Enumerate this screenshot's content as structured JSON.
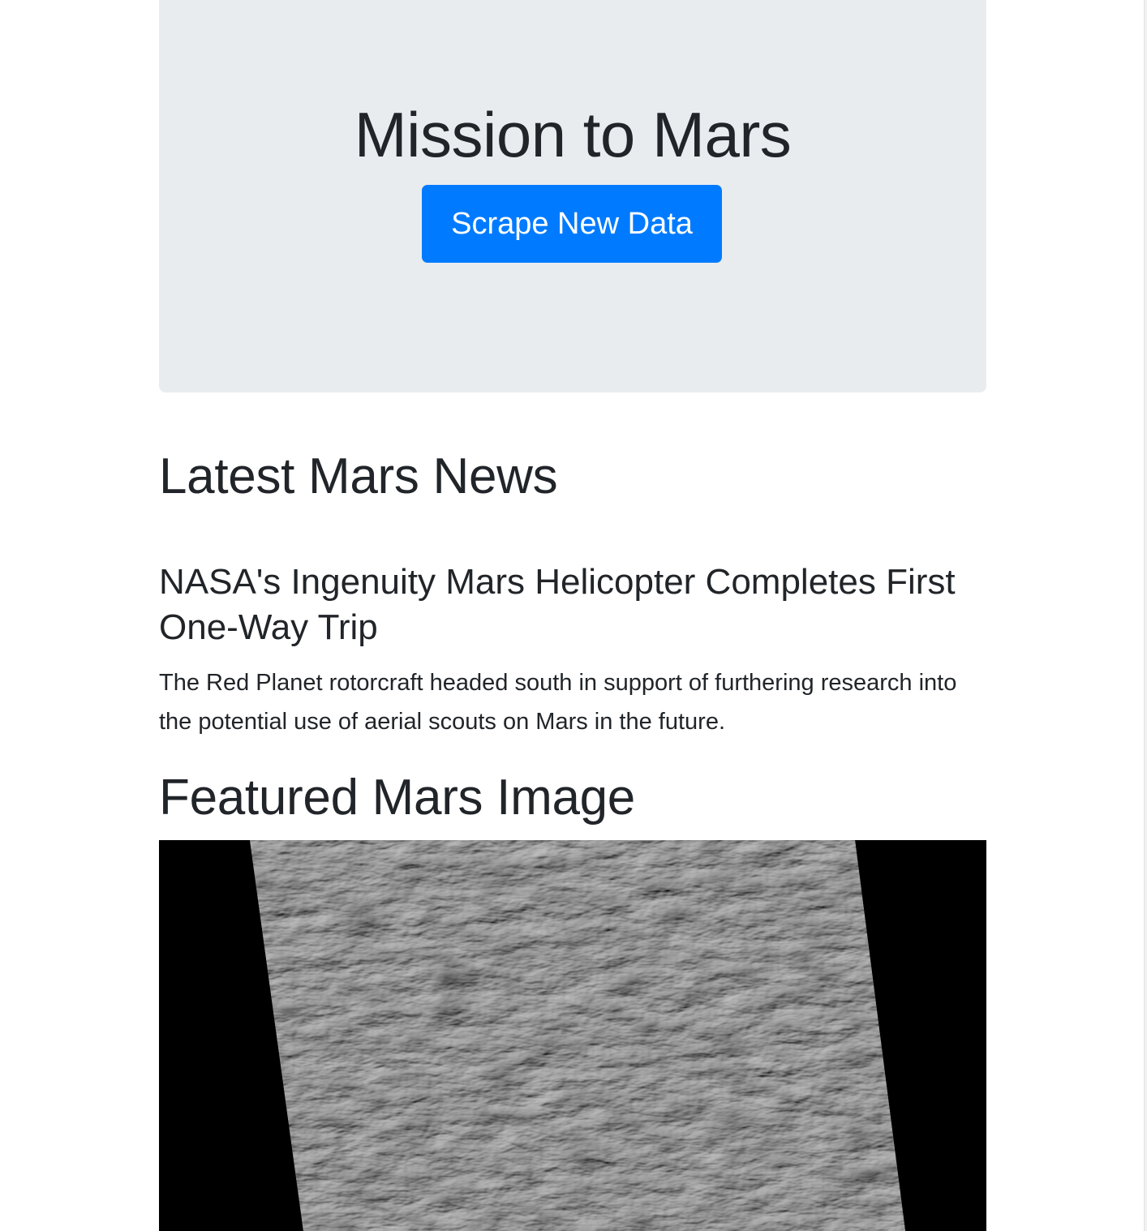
{
  "jumbotron": {
    "title": "Mission to Mars",
    "button_label": "Scrape New Data"
  },
  "news": {
    "heading": "Latest Mars News",
    "title": "NASA's Ingenuity Mars Helicopter Completes First One-Way Trip",
    "teaser": "The Red Planet rotorcraft headed south in support of furthering research into the potential use of aerial scouts on Mars in the future."
  },
  "featured_image": {
    "heading": "Featured Mars Image"
  },
  "colors": {
    "primary": "#007bff",
    "jumbotron_bg": "#e9ecef",
    "text": "#212529"
  }
}
